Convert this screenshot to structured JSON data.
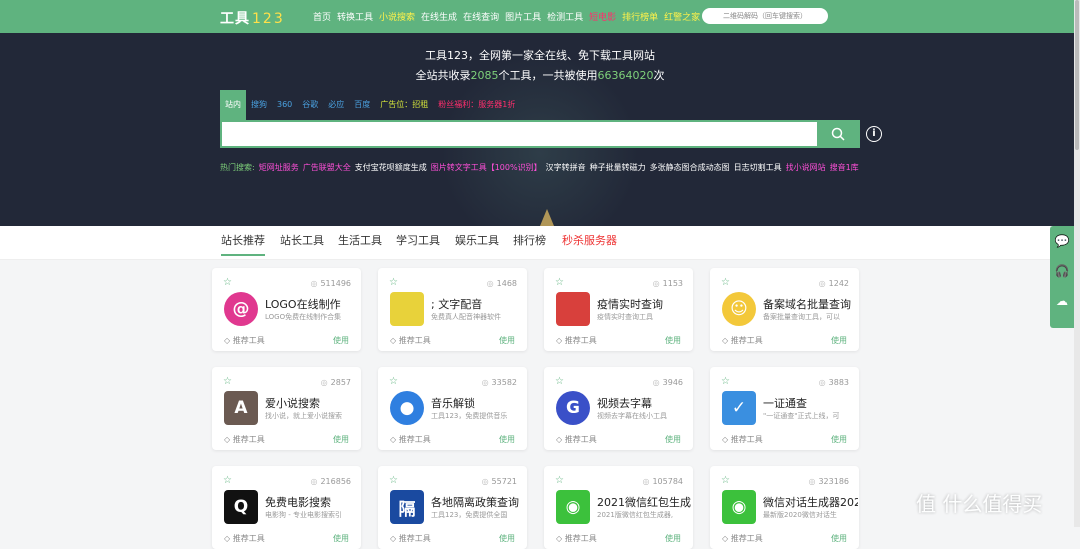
{
  "header": {
    "logo_text": "工具",
    "logo_num": "123",
    "nav": [
      {
        "label": "首页",
        "style": "normal"
      },
      {
        "label": "转换工具",
        "style": "normal"
      },
      {
        "label": "小说搜索",
        "style": "yellow"
      },
      {
        "label": "在线生成",
        "style": "normal"
      },
      {
        "label": "在线查询",
        "style": "normal"
      },
      {
        "label": "图片工具",
        "style": "normal"
      },
      {
        "label": "检测工具",
        "style": "normal"
      },
      {
        "label": "短电影",
        "style": "red"
      },
      {
        "label": "排行榜单",
        "style": "yellow"
      },
      {
        "label": "红警之家",
        "style": "yellow"
      }
    ],
    "top_search_placeholder": "二维码解码（回车键搜索）"
  },
  "hero": {
    "line1": "工具123，全网第一家全在线、免下载工具网站",
    "line2_a": "全站共收录",
    "tool_count": "2085",
    "line2_b": "个工具，一共被使用",
    "use_count": "66364020",
    "line2_c": "次"
  },
  "search": {
    "tabs": [
      {
        "label": "站内",
        "active": true
      },
      {
        "label": "搜狗"
      },
      {
        "label": "360"
      },
      {
        "label": "谷歌"
      },
      {
        "label": "必应"
      },
      {
        "label": "百度"
      }
    ],
    "ad1": "广告位：招租",
    "ad2": "粉丝福利：服务器1折",
    "value": ""
  },
  "hot": {
    "label": "热门搜索:",
    "items": [
      {
        "text": "矩网址服务",
        "c": "m"
      },
      {
        "text": "广告联盟大全",
        "c": "m"
      },
      {
        "text": "支付宝花呗额度生成",
        "c": "w"
      },
      {
        "text": "图片转文字工具【100%识别】",
        "c": "m"
      },
      {
        "text": "汉字转拼音",
        "c": "w"
      },
      {
        "text": "种子批量转磁力",
        "c": "w"
      },
      {
        "text": "多张静态图合成动态图",
        "c": "w"
      },
      {
        "text": "日志切割工具",
        "c": "w"
      },
      {
        "text": "找小说网站",
        "c": "m"
      },
      {
        "text": "搜音1库",
        "c": "m"
      }
    ]
  },
  "categories": [
    "站长推荐",
    "站长工具",
    "生活工具",
    "学习工具",
    "娱乐工具",
    "排行榜",
    "秒杀服务器"
  ],
  "cards": [
    {
      "views": "511496",
      "title": "LOGO在线制作",
      "desc": "LOGO免费在线制作合集",
      "foot": "推荐工具",
      "use": "使用",
      "icon": "@",
      "color": "#e0388f",
      "round": true
    },
    {
      "views": "1468",
      "title": "; 文字配音",
      "desc": "免费真人配音神器软件",
      "foot": "推荐工具",
      "use": "使用",
      "icon": "",
      "color": "#e8d23a",
      "round": false
    },
    {
      "views": "1153",
      "title": "疫情实时查询",
      "desc": "疫情实时查询工具",
      "foot": "推荐工具",
      "use": "使用",
      "icon": "",
      "color": "#d8403c",
      "round": false
    },
    {
      "views": "1242",
      "title": "备案域名批量查询",
      "desc": "备案批量查询工具，可以",
      "foot": "推荐工具",
      "use": "使用",
      "icon": "☺",
      "color": "#f3c83a",
      "round": true
    },
    {
      "views": "2857",
      "title": "爱小说搜索",
      "desc": "找小说，就上爱小说搜索",
      "foot": "推荐工具",
      "use": "使用",
      "icon": "A",
      "color": "#6b5a52",
      "round": false
    },
    {
      "views": "33582",
      "title": "音乐解锁",
      "desc": "工具123，免费提供音乐",
      "foot": "推荐工具",
      "use": "使用",
      "icon": "●",
      "color": "#2f7fe0",
      "round": true
    },
    {
      "views": "3946",
      "title": "视频去字幕",
      "desc": "视频去字幕在线小工具",
      "foot": "推荐工具",
      "use": "使用",
      "icon": "G",
      "color": "#3a50c8",
      "round": true
    },
    {
      "views": "3883",
      "title": "一证通查",
      "desc": "\"一证通查\"正式上线，可",
      "foot": "推荐工具",
      "use": "使用",
      "icon": "✓",
      "color": "#3a8fe0",
      "round": false
    },
    {
      "views": "216856",
      "title": "免费电影搜索",
      "desc": "电影狗 - 专业电影搜索引",
      "foot": "推荐工具",
      "use": "使用",
      "icon": "Q",
      "color": "#111111",
      "round": false
    },
    {
      "views": "55721",
      "title": "各地隔离政策查询",
      "desc": "工具123，免费提供全国",
      "foot": "推荐工具",
      "use": "使用",
      "icon": "隔",
      "color": "#1a4aa0",
      "round": false
    },
    {
      "views": "105784",
      "title": "2021微信红包生成",
      "desc": "2021版微信红包生成器,",
      "foot": "推荐工具",
      "use": "使用",
      "icon": "◉",
      "color": "#3cc13c",
      "round": false
    },
    {
      "views": "323186",
      "title": "微信对话生成器202",
      "desc": "最新版2020微信对话生",
      "foot": "推荐工具",
      "use": "使用",
      "icon": "◉",
      "color": "#3cc13c",
      "round": false
    }
  ],
  "side": [
    "💬",
    "🎧",
    "☁"
  ],
  "watermark": "值 什么值得买"
}
